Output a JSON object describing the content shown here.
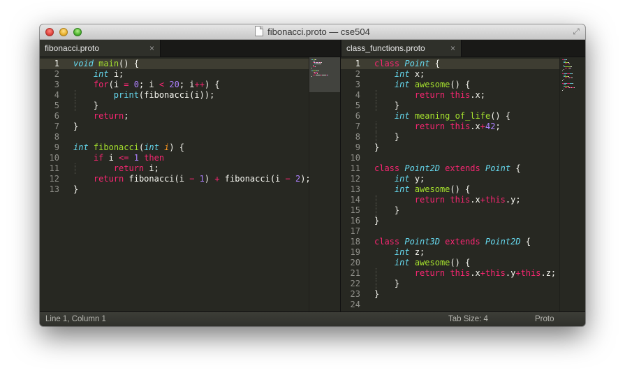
{
  "window": {
    "title": "fibonacci.proto — cse504"
  },
  "tabs": [
    {
      "label": "fibonacci.proto",
      "close": "×"
    },
    {
      "label": "class_functions.proto",
      "close": "×"
    }
  ],
  "left_pane": {
    "line_numbers": [
      "1",
      "2",
      "3",
      "4",
      "5",
      "6",
      "7",
      "8",
      "9",
      "10",
      "11",
      "12",
      "13"
    ],
    "current_line": 1,
    "lines": [
      [
        [
          "ty",
          "void"
        ],
        [
          "t",
          " "
        ],
        [
          "fn",
          "main"
        ],
        [
          "t",
          "() {"
        ]
      ],
      [
        [
          "t",
          "    "
        ],
        [
          "ty",
          "int"
        ],
        [
          "t",
          " i;"
        ]
      ],
      [
        [
          "t",
          "    "
        ],
        [
          "kw",
          "for"
        ],
        [
          "t",
          "(i "
        ],
        [
          "kw",
          "="
        ],
        [
          "t",
          " "
        ],
        [
          "nm",
          "0"
        ],
        [
          "t",
          "; i "
        ],
        [
          "kw",
          "<"
        ],
        [
          "t",
          " "
        ],
        [
          "nm",
          "20"
        ],
        [
          "t",
          "; i"
        ],
        [
          "kw",
          "++"
        ],
        [
          "t",
          ") {"
        ]
      ],
      [
        [
          "t",
          "        "
        ],
        [
          "bi",
          "print"
        ],
        [
          "t",
          "(fibonacci(i));"
        ]
      ],
      [
        [
          "t",
          "    }"
        ]
      ],
      [
        [
          "t",
          "    "
        ],
        [
          "kw",
          "return"
        ],
        [
          "t",
          ";"
        ]
      ],
      [
        [
          "t",
          "}"
        ]
      ],
      [
        [
          "t",
          ""
        ]
      ],
      [
        [
          "ty",
          "int"
        ],
        [
          "t",
          " "
        ],
        [
          "fn",
          "fibonacci"
        ],
        [
          "t",
          "("
        ],
        [
          "ty",
          "int"
        ],
        [
          "t",
          " "
        ],
        [
          "ar",
          "i"
        ],
        [
          "t",
          ") {"
        ]
      ],
      [
        [
          "t",
          "    "
        ],
        [
          "kw",
          "if"
        ],
        [
          "t",
          " i "
        ],
        [
          "kw",
          "<="
        ],
        [
          "t",
          " "
        ],
        [
          "nm",
          "1"
        ],
        [
          "t",
          " "
        ],
        [
          "kw",
          "then"
        ]
      ],
      [
        [
          "t",
          "        "
        ],
        [
          "kw",
          "return"
        ],
        [
          "t",
          " i;"
        ]
      ],
      [
        [
          "t",
          "    "
        ],
        [
          "kw",
          "return"
        ],
        [
          "t",
          " fibonacci(i "
        ],
        [
          "kw",
          "−"
        ],
        [
          "t",
          " "
        ],
        [
          "nm",
          "1"
        ],
        [
          "t",
          ") "
        ],
        [
          "kw",
          "+"
        ],
        [
          "t",
          " fibonacci(i "
        ],
        [
          "kw",
          "−"
        ],
        [
          "t",
          " "
        ],
        [
          "nm",
          "2"
        ],
        [
          "t",
          ");"
        ]
      ],
      [
        [
          "t",
          "}"
        ]
      ]
    ]
  },
  "right_pane": {
    "line_numbers": [
      "1",
      "2",
      "3",
      "4",
      "5",
      "6",
      "7",
      "8",
      "9",
      "10",
      "11",
      "12",
      "13",
      "14",
      "15",
      "16",
      "17",
      "18",
      "19",
      "20",
      "21",
      "22",
      "23",
      "24"
    ],
    "current_line": 1,
    "lines": [
      [
        [
          "kw",
          "class"
        ],
        [
          "t",
          " "
        ],
        [
          "cls",
          "Point"
        ],
        [
          "t",
          " {"
        ]
      ],
      [
        [
          "t",
          "    "
        ],
        [
          "ty",
          "int"
        ],
        [
          "t",
          " x;"
        ]
      ],
      [
        [
          "t",
          "    "
        ],
        [
          "ty",
          "int"
        ],
        [
          "t",
          " "
        ],
        [
          "fn",
          "awesome"
        ],
        [
          "t",
          "() {"
        ]
      ],
      [
        [
          "t",
          "        "
        ],
        [
          "kw",
          "return"
        ],
        [
          "t",
          " "
        ],
        [
          "kw",
          "this"
        ],
        [
          "t",
          ".x;"
        ]
      ],
      [
        [
          "t",
          "    }"
        ]
      ],
      [
        [
          "t",
          "    "
        ],
        [
          "ty",
          "int"
        ],
        [
          "t",
          " "
        ],
        [
          "fn",
          "meaning_of_life"
        ],
        [
          "t",
          "() {"
        ]
      ],
      [
        [
          "t",
          "        "
        ],
        [
          "kw",
          "return"
        ],
        [
          "t",
          " "
        ],
        [
          "kw",
          "this"
        ],
        [
          "t",
          ".x"
        ],
        [
          "kw",
          "+"
        ],
        [
          "nm",
          "42"
        ],
        [
          "t",
          ";"
        ]
      ],
      [
        [
          "t",
          "    }"
        ]
      ],
      [
        [
          "t",
          "}"
        ]
      ],
      [
        [
          "t",
          ""
        ]
      ],
      [
        [
          "kw",
          "class"
        ],
        [
          "t",
          " "
        ],
        [
          "cls",
          "Point2D"
        ],
        [
          "t",
          " "
        ],
        [
          "kw",
          "extends"
        ],
        [
          "t",
          " "
        ],
        [
          "cls",
          "Point"
        ],
        [
          "t",
          " {"
        ]
      ],
      [
        [
          "t",
          "    "
        ],
        [
          "ty",
          "int"
        ],
        [
          "t",
          " y;"
        ]
      ],
      [
        [
          "t",
          "    "
        ],
        [
          "ty",
          "int"
        ],
        [
          "t",
          " "
        ],
        [
          "fn",
          "awesome"
        ],
        [
          "t",
          "() {"
        ]
      ],
      [
        [
          "t",
          "        "
        ],
        [
          "kw",
          "return"
        ],
        [
          "t",
          " "
        ],
        [
          "kw",
          "this"
        ],
        [
          "t",
          ".x"
        ],
        [
          "kw",
          "+"
        ],
        [
          "kw",
          "this"
        ],
        [
          "t",
          ".y;"
        ]
      ],
      [
        [
          "t",
          "    }"
        ]
      ],
      [
        [
          "t",
          "}"
        ]
      ],
      [
        [
          "t",
          ""
        ]
      ],
      [
        [
          "kw",
          "class"
        ],
        [
          "t",
          " "
        ],
        [
          "cls",
          "Point3D"
        ],
        [
          "t",
          " "
        ],
        [
          "kw",
          "extends"
        ],
        [
          "t",
          " "
        ],
        [
          "cls",
          "Point2D"
        ],
        [
          "t",
          " {"
        ]
      ],
      [
        [
          "t",
          "    "
        ],
        [
          "ty",
          "int"
        ],
        [
          "t",
          " z;"
        ]
      ],
      [
        [
          "t",
          "    "
        ],
        [
          "ty",
          "int"
        ],
        [
          "t",
          " "
        ],
        [
          "fn",
          "awesome"
        ],
        [
          "t",
          "() {"
        ]
      ],
      [
        [
          "t",
          "        "
        ],
        [
          "kw",
          "return"
        ],
        [
          "t",
          " "
        ],
        [
          "kw",
          "this"
        ],
        [
          "t",
          ".x"
        ],
        [
          "kw",
          "+"
        ],
        [
          "kw",
          "this"
        ],
        [
          "t",
          ".y"
        ],
        [
          "kw",
          "+"
        ],
        [
          "kw",
          "this"
        ],
        [
          "t",
          ".z;"
        ]
      ],
      [
        [
          "t",
          "    }"
        ]
      ],
      [
        [
          "t",
          "}"
        ]
      ],
      [
        [
          "t",
          ""
        ]
      ]
    ]
  },
  "statusbar": {
    "position": "Line 1, Column 1",
    "tab_size": "Tab Size: 4",
    "syntax": "Proto"
  },
  "colors": {
    "background": "#272822",
    "keyword": "#f92672",
    "type": "#66d9ef",
    "function": "#a6e22e",
    "number": "#ae81ff",
    "argument": "#fd971f",
    "text": "#f8f8f2"
  }
}
